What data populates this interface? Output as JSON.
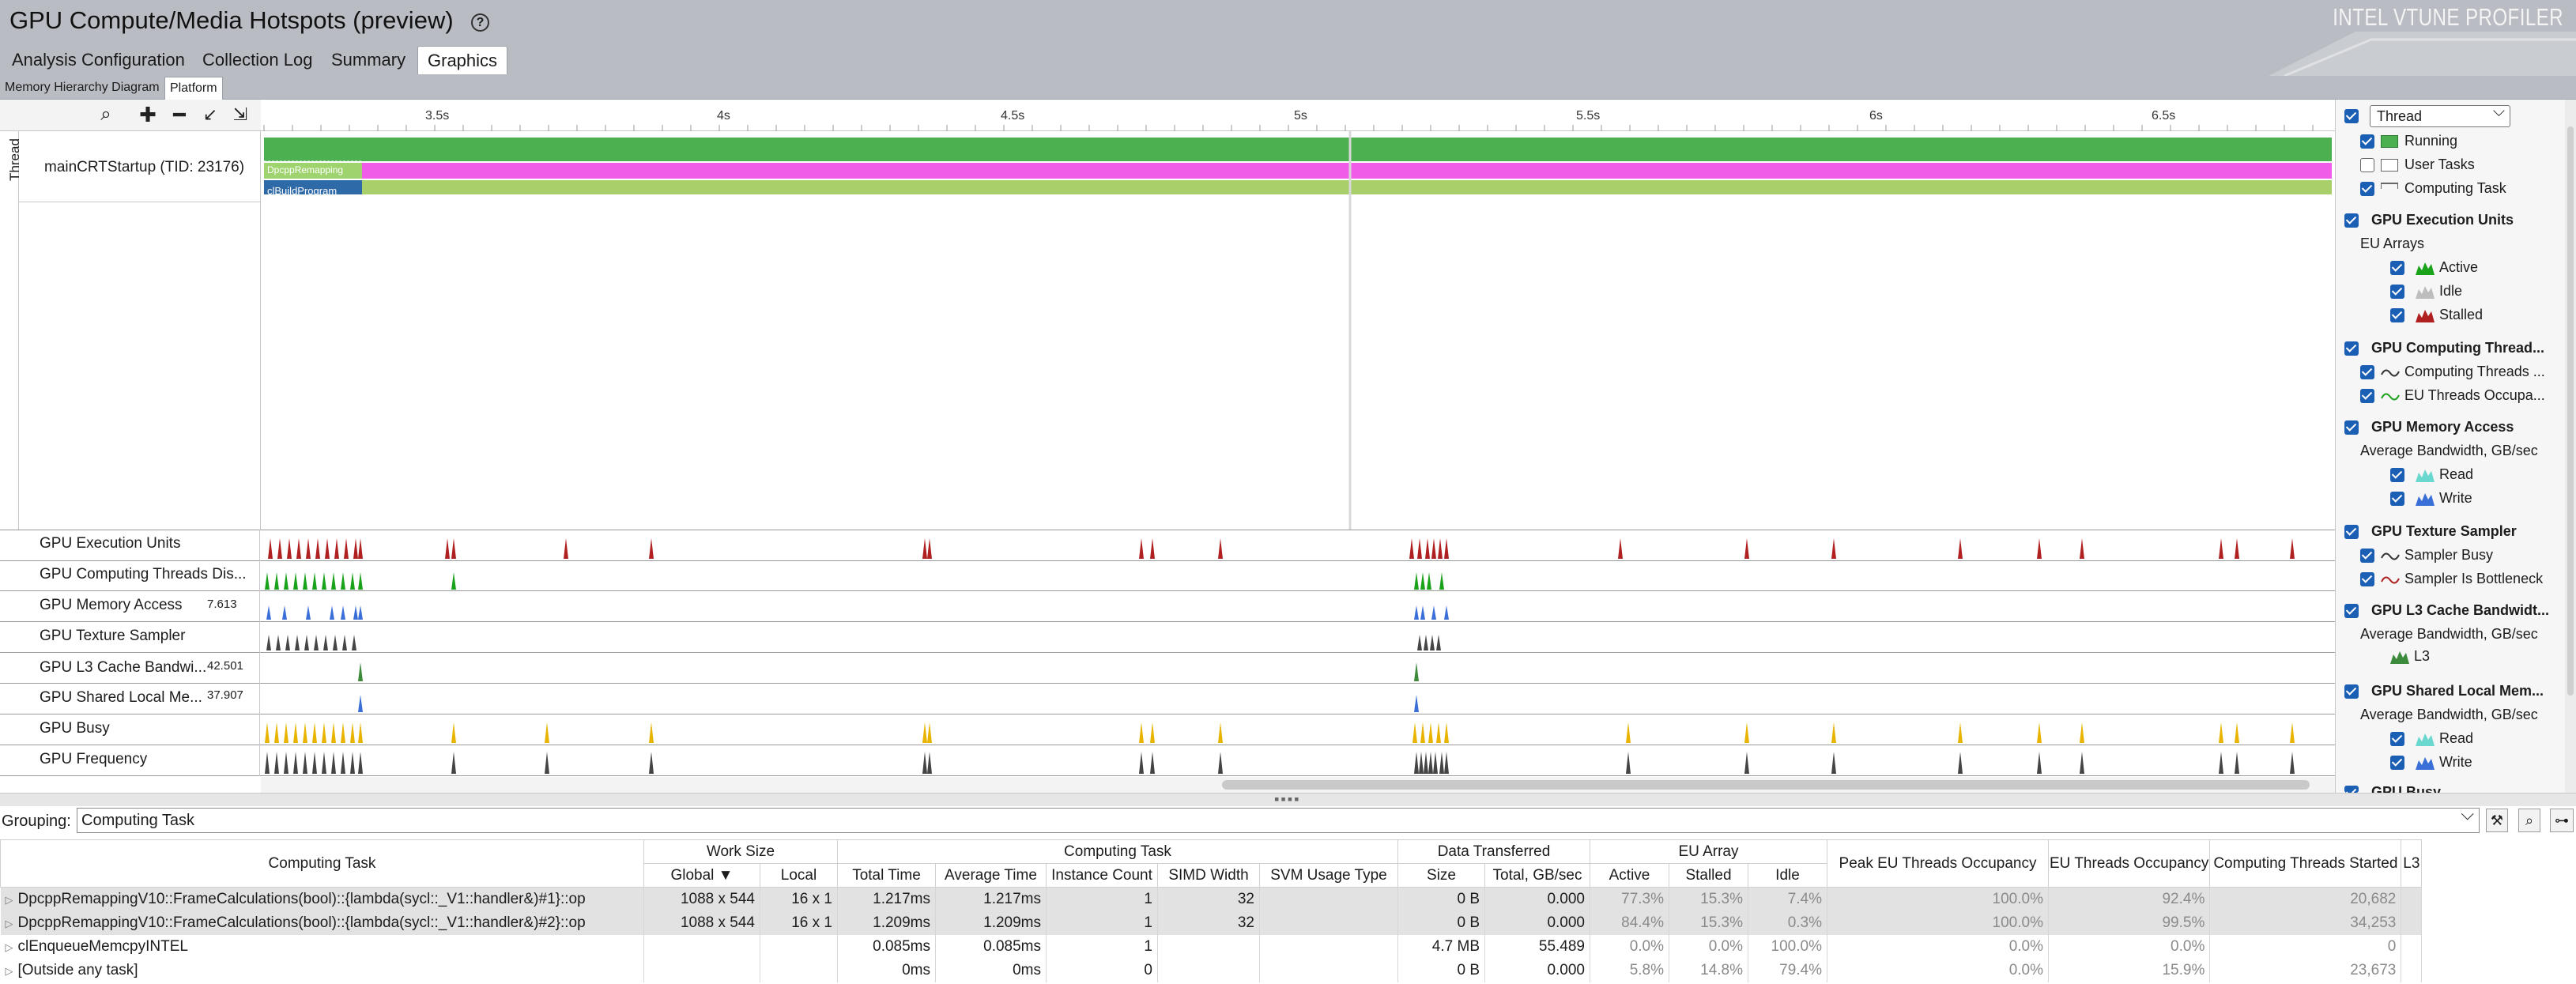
{
  "header": {
    "title": "GPU Compute/Media Hotspots (preview)",
    "brand": "INTEL VTUNE PROFILER",
    "tabs": [
      "Analysis Configuration",
      "Collection Log",
      "Summary",
      "Graphics"
    ],
    "active_tab": "Graphics",
    "subtabs": [
      "Memory Hierarchy Diagram",
      "Platform"
    ],
    "active_subtab": "Platform"
  },
  "colors": {
    "running": "#4caf50",
    "user_task": "#f05ce8",
    "computing_task": "#a9cf6a",
    "eu_active": "#1aa31a",
    "eu_idle": "#bdbdbd",
    "eu_stalled": "#b02020",
    "memory_read": "#6ad8cf",
    "memory_write": "#3a6fd8",
    "gpu_busy": "#e8b400",
    "frequency": "#444444",
    "l3": "#3c8a3c"
  },
  "timeline": {
    "toolbar_icons": [
      "zoom-icon",
      "zoom-in-icon",
      "zoom-out-icon",
      "undo-zoom-icon",
      "reset-zoom-icon"
    ],
    "ticks": [
      "3.5s",
      "4s",
      "4.5s",
      "5s",
      "5.5s",
      "6s",
      "6.5s"
    ],
    "thread_group_label": "Thread",
    "thread_name": "mainCRTStartup (TID: 23176)",
    "task_labels": {
      "user_task": "DpcppRemapping",
      "computing_task": "clBuildProgram"
    },
    "rows": [
      {
        "label": "GPU Execution Units",
        "value": ""
      },
      {
        "label": "GPU Computing Threads Dis...",
        "value": ""
      },
      {
        "label": "GPU Memory Access",
        "value": "7.613"
      },
      {
        "label": "GPU Texture Sampler",
        "value": ""
      },
      {
        "label": "GPU L3 Cache Bandwi...",
        "value": "42.501"
      },
      {
        "label": "GPU Shared Local Me...",
        "value": "37.907"
      },
      {
        "label": "GPU Busy",
        "value": ""
      },
      {
        "label": "GPU Frequency",
        "value": ""
      }
    ]
  },
  "legend": {
    "thread_select": "Thread",
    "items": [
      {
        "label": "Running",
        "checked": true
      },
      {
        "label": "User Tasks",
        "checked": false
      },
      {
        "label": "Computing Task",
        "checked": true
      }
    ],
    "sections": [
      {
        "title": "GPU Execution Units",
        "sub": "EU Arrays",
        "items": [
          "Active",
          "Idle",
          "Stalled"
        ]
      },
      {
        "title": "GPU Computing Thread...",
        "sub": "",
        "items": [
          "Computing Threads ...",
          "EU Threads Occupa..."
        ]
      },
      {
        "title": "GPU Memory Access",
        "sub": "Average Bandwidth, GB/sec",
        "items": [
          "Read",
          "Write"
        ]
      },
      {
        "title": "GPU Texture Sampler",
        "sub": "",
        "items": [
          "Sampler Busy",
          "Sampler Is Bottleneck"
        ]
      },
      {
        "title": "GPU L3 Cache Bandwidt...",
        "sub": "Average Bandwidth, GB/sec",
        "items": [
          "L3"
        ]
      },
      {
        "title": "GPU Shared Local Mem...",
        "sub": "Average Bandwidth, GB/sec",
        "items": [
          "Read",
          "Write"
        ]
      },
      {
        "title": "GPU Busy",
        "sub": "",
        "items": []
      }
    ]
  },
  "grid": {
    "grouping_label": "Grouping:",
    "grouping_value": "Computing Task",
    "group_headers": [
      "Work Size",
      "Computing Task",
      "Data Transferred",
      "EU Array"
    ],
    "columns": [
      "Computing Task",
      "Global ▼",
      "Local",
      "Total Time",
      "Average Time",
      "Instance Count",
      "SIMD Width",
      "SVM Usage Type",
      "Size",
      "Total, GB/sec",
      "Active",
      "Stalled",
      "Idle",
      "Peak EU Threads Occupancy",
      "EU Threads Occupancy",
      "Computing Threads Started",
      "L3"
    ],
    "rows": [
      [
        "DpcppRemappingV10::FrameCalculations(bool)::{lambda(sycl::_V1::handler&)#1}::op",
        "1088 x 544",
        "16 x 1",
        "1.217ms",
        "1.217ms",
        "1",
        "32",
        "",
        "0 B",
        "0.000",
        "77.3%",
        "15.3%",
        "7.4%",
        "100.0%",
        "92.4%",
        "20,682"
      ],
      [
        "DpcppRemappingV10::FrameCalculations(bool)::{lambda(sycl::_V1::handler&)#2}::op",
        "1088 x 544",
        "16 x 1",
        "1.209ms",
        "1.209ms",
        "1",
        "32",
        "",
        "0 B",
        "0.000",
        "84.4%",
        "15.3%",
        "0.3%",
        "100.0%",
        "99.5%",
        "34,253"
      ],
      [
        "clEnqueueMemcpyINTEL",
        "",
        "",
        "0.085ms",
        "0.085ms",
        "1",
        "",
        "",
        "4.7 MB",
        "55.489",
        "0.0%",
        "0.0%",
        "100.0%",
        "0.0%",
        "0.0%",
        "0"
      ],
      [
        "[Outside any task]",
        "",
        "",
        "0ms",
        "0ms",
        "0",
        "",
        "",
        "0 B",
        "0.000",
        "5.8%",
        "14.8%",
        "79.4%",
        "0.0%",
        "15.9%",
        "23,673"
      ]
    ]
  }
}
